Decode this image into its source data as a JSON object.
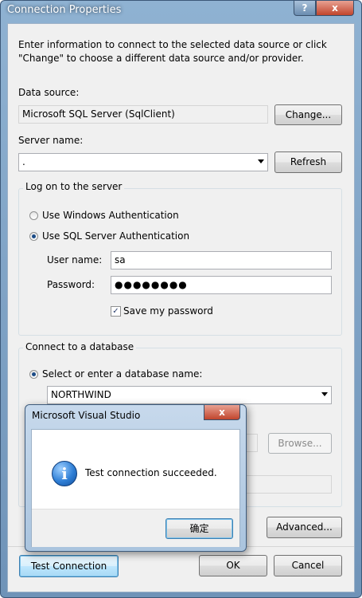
{
  "window": {
    "title": "Connection Properties",
    "help_label": "?",
    "close_label": "x"
  },
  "intro": "Enter information to connect to the selected data source or click \"Change\" to choose a different data source and/or provider.",
  "data_source": {
    "label": "Data source:",
    "value": "Microsoft SQL Server (SqlClient)",
    "change_label": "Change..."
  },
  "server": {
    "label": "Server name:",
    "value": ".",
    "refresh_label": "Refresh"
  },
  "logon": {
    "group_title": "Log on to the server",
    "windows_auth_label": "Use Windows Authentication",
    "sql_auth_label": "Use SQL Server Authentication",
    "selected": "sql",
    "user_name_label": "User name:",
    "user_name_value": "sa",
    "password_label": "Password:",
    "password_value": "●●●●●●●●",
    "save_password_label": "Save my password",
    "save_password_checked": true
  },
  "database": {
    "group_title": "Connect to a database",
    "select_label": "Select or enter a database name:",
    "select_value": "NORTHWIND",
    "browse_label": "Browse..."
  },
  "buttons": {
    "advanced_label": "Advanced...",
    "test_connection_label": "Test Connection",
    "ok_label": "OK",
    "cancel_label": "Cancel"
  },
  "message_box": {
    "title": "Microsoft Visual Studio",
    "close_label": "x",
    "icon": "info-icon",
    "message": "Test connection succeeded.",
    "ok_label": "确定"
  }
}
